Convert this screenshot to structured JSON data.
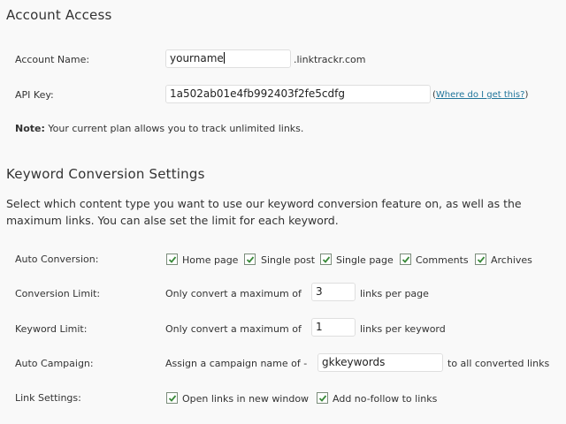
{
  "account": {
    "title": "Account Access",
    "name_label": "Account Name:",
    "name_value": "yourname",
    "name_suffix": ".linktrackr.com",
    "api_label": "API Key:",
    "api_value": "1a502ab01e4fb992403f2fe5cdfg",
    "api_help_open": "(",
    "api_help_link": "Where do I get this?",
    "api_help_close": ")",
    "note_label": "Note:",
    "note_text": " Your current plan allows you to track unlimited links."
  },
  "keyword": {
    "title": "Keyword Conversion Settings",
    "description": "Select which content type you want to use our keyword conversion feature on, as well as the maximum links. You can alse set the limit for each keyword.",
    "auto_conversion_label": "Auto Conversion:",
    "auto_conversion_options": [
      {
        "label": "Home page",
        "checked": true
      },
      {
        "label": "Single post",
        "checked": true
      },
      {
        "label": "Single page",
        "checked": true
      },
      {
        "label": "Comments",
        "checked": true
      },
      {
        "label": "Archives",
        "checked": true
      }
    ],
    "conversion_limit_label": "Conversion Limit:",
    "conversion_limit_prefix": "Only convert a maximum of",
    "conversion_limit_value": "3",
    "conversion_limit_suffix": "links per page",
    "keyword_limit_label": "Keyword Limit:",
    "keyword_limit_prefix": "Only convert a maximum of",
    "keyword_limit_value": "1",
    "keyword_limit_suffix": "links per keyword",
    "auto_campaign_label": "Auto Campaign:",
    "auto_campaign_prefix": "Assign a campaign name of -",
    "auto_campaign_value": "gkkeywords",
    "auto_campaign_suffix": "to all converted links",
    "link_settings_label": "Link Settings:",
    "link_settings_options": [
      {
        "label": "Open links in new window",
        "checked": true
      },
      {
        "label": "Add no-follow to links",
        "checked": true
      }
    ]
  },
  "colors": {
    "background": "#f9f9f9",
    "text": "#333333",
    "link": "#21759b",
    "check": "#3a8a3a"
  }
}
